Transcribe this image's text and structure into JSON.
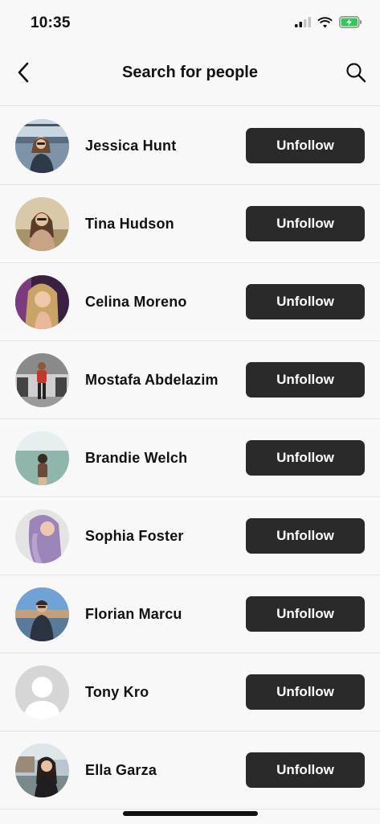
{
  "status_bar": {
    "time": "10:35",
    "icons": [
      "cellular-signal-icon",
      "wifi-icon",
      "battery-charging-icon"
    ],
    "battery_color": "#34c759"
  },
  "nav": {
    "title": "Search for people",
    "back_icon": "chevron-left-icon",
    "search_icon": "search-icon"
  },
  "people": [
    {
      "name": "Jessica Hunt",
      "action": "Unfollow",
      "avatar": "photo"
    },
    {
      "name": "Tina Hudson",
      "action": "Unfollow",
      "avatar": "photo"
    },
    {
      "name": "Celina Moreno",
      "action": "Unfollow",
      "avatar": "photo"
    },
    {
      "name": "Mostafa Abdelazim",
      "action": "Unfollow",
      "avatar": "photo"
    },
    {
      "name": "Brandie Welch",
      "action": "Unfollow",
      "avatar": "photo"
    },
    {
      "name": "Sophia Foster",
      "action": "Unfollow",
      "avatar": "photo"
    },
    {
      "name": "Florian Marcu",
      "action": "Unfollow",
      "avatar": "photo"
    },
    {
      "name": "Tony Kro",
      "action": "Unfollow",
      "avatar": "placeholder"
    },
    {
      "name": "Ella Garza",
      "action": "Unfollow",
      "avatar": "photo"
    }
  ],
  "colors": {
    "background": "#f8f8f8",
    "button": "#2a2a2a",
    "button_text": "#ffffff",
    "divider": "#e4e4e4"
  }
}
